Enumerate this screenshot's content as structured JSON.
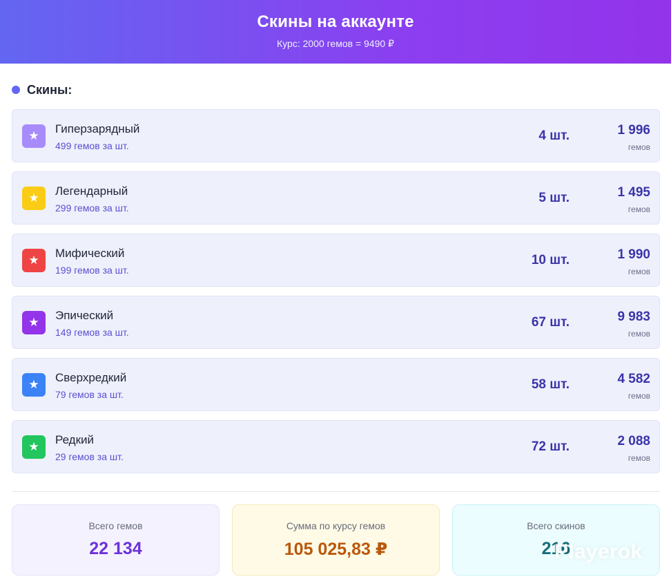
{
  "header": {
    "title": "Скины на аккаунте",
    "subtitle": "Курс: 2000 гемов = 9490 ₽"
  },
  "section": {
    "title": "Скины:"
  },
  "skins": [
    {
      "name": "Гиперзарядный",
      "price": "499 гемов за шт.",
      "qty": "4 шт.",
      "total": "1 996",
      "unit": "гемов",
      "icon": "star-icon",
      "color": "#a78bfa"
    },
    {
      "name": "Легендарный",
      "price": "299 гемов за шт.",
      "qty": "5 шт.",
      "total": "1 495",
      "unit": "гемов",
      "icon": "star-icon",
      "color": "#facc15"
    },
    {
      "name": "Мифический",
      "price": "199 гемов за шт.",
      "qty": "10 шт.",
      "total": "1 990",
      "unit": "гемов",
      "icon": "star-icon",
      "color": "#ef4444"
    },
    {
      "name": "Эпический",
      "price": "149 гемов за шт.",
      "qty": "67 шт.",
      "total": "9 983",
      "unit": "гемов",
      "icon": "star-icon",
      "color": "#9333ea"
    },
    {
      "name": "Сверхредкий",
      "price": "79 гемов за шт.",
      "qty": "58 шт.",
      "total": "4 582",
      "unit": "гемов",
      "icon": "star-icon",
      "color": "#3b82f6"
    },
    {
      "name": "Редкий",
      "price": "29 гемов за шт.",
      "qty": "72 шт.",
      "total": "2 088",
      "unit": "гемов",
      "icon": "star-icon",
      "color": "#22c55e"
    }
  ],
  "summary": {
    "gems_label": "Всего гемов",
    "gems_value": "22 134",
    "sum_label": "Сумма по курсу гемов",
    "sum_value": "105 025,83 ₽",
    "skins_label": "Всего скинов",
    "skins_value": "216"
  },
  "watermark": "Playerok"
}
